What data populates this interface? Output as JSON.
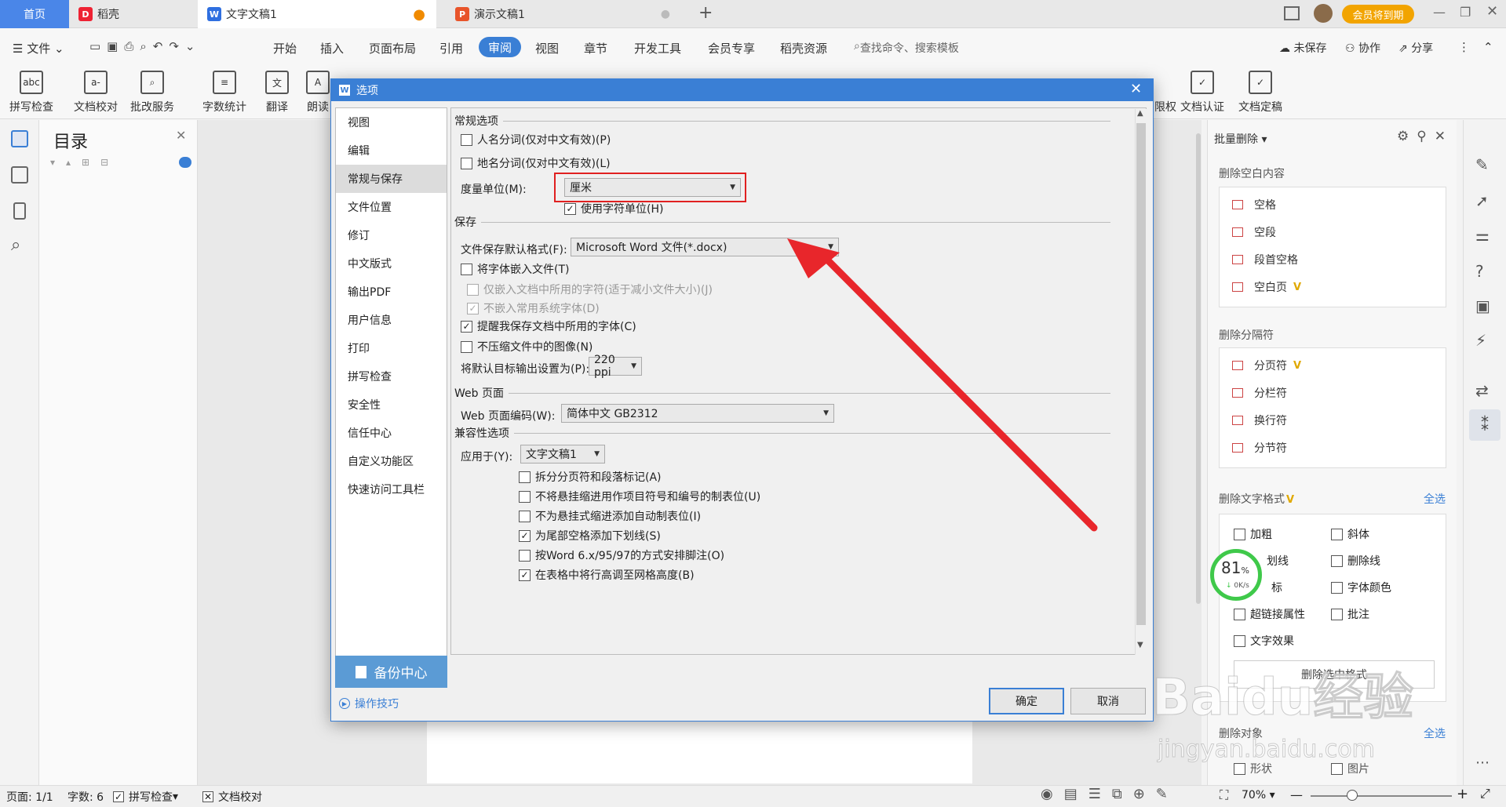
{
  "tabs": {
    "home": "首页",
    "daoke": "稻壳",
    "doc": "文字文稿1",
    "ppt": "演示文稿1",
    "vip_badge": "会员将到期"
  },
  "menu": {
    "file": "文件",
    "items": [
      "开始",
      "插入",
      "页面布局",
      "引用",
      "审阅",
      "视图",
      "章节",
      "开发工具",
      "会员专享",
      "稻壳资源"
    ],
    "active": "审阅",
    "search_placeholder": "查找命令、搜索模板",
    "unsaved": "未保存",
    "collab": "协作",
    "share": "分享"
  },
  "ribbon": {
    "left": [
      {
        "label": "拼写检查",
        "icon": "abc"
      },
      {
        "label": "文档校对",
        "icon": "a-"
      },
      {
        "label": "批改服务",
        "icon": "lens"
      },
      {
        "label": "字数统计",
        "icon": "lines"
      },
      {
        "label": "翻译",
        "icon": "translate"
      },
      {
        "label": "朗读",
        "icon": "A"
      }
    ],
    "right": [
      {
        "label": "限权",
        "icon": "lock"
      },
      {
        "label": "文档认证",
        "icon": "doc-check"
      },
      {
        "label": "文档定稿",
        "icon": "doc-final"
      }
    ]
  },
  "toc": {
    "title": "目录"
  },
  "dialog": {
    "title": "选项",
    "nav": [
      "视图",
      "编辑",
      "常规与保存",
      "文件位置",
      "修订",
      "中文版式",
      "输出PDF",
      "用户信息",
      "打印",
      "拼写检查",
      "安全性",
      "信任中心",
      "自定义功能区",
      "快速访问工具栏"
    ],
    "nav_selected": "常规与保存",
    "backup": "备份中心",
    "tips": "操作技巧",
    "sections": {
      "general": "常规选项",
      "save": "保存",
      "web": "Web 页面",
      "compat": "兼容性选项"
    },
    "general": {
      "name_seg": "人名分词(仅对中文有效)(P)",
      "place_seg": "地名分词(仅对中文有效)(L)",
      "unit_label": "度量单位(M):",
      "unit_value": "厘米",
      "use_char_unit": "使用字符单位(H)"
    },
    "save": {
      "format_label": "文件保存默认格式(F):",
      "format_value": "Microsoft Word 文件(*.docx)",
      "embed_font": "将字体嵌入文件(T)",
      "embed_used_only": "仅嵌入文档中所用的字符(适于减小文件大小)(J)",
      "no_embed_system": "不嵌入常用系统字体(D)",
      "remind_font": "提醒我保存文档中所用的字体(C)",
      "no_compress": "不压缩文件中的图像(N)",
      "ppi_label": "将默认目标输出设置为(P):",
      "ppi_value": "220 ppi"
    },
    "web": {
      "encoding_label": "Web 页面编码(W):",
      "encoding_value": "简体中文 GB2312"
    },
    "compat": {
      "apply_label": "应用于(Y):",
      "apply_value": "文字文稿1",
      "opt1": "拆分分页符和段落标记(A)",
      "opt2": "不将悬挂缩进用作项目符号和编号的制表位(U)",
      "opt3": "不为悬挂式缩进添加自动制表位(I)",
      "opt4": "为尾部空格添加下划线(S)",
      "opt5": "按Word 6.x/95/97的方式安排脚注(O)",
      "opt6": "在表格中将行高调至网格高度(B)"
    },
    "ok": "确定",
    "cancel": "取消"
  },
  "right_panel": {
    "header": "批量删除",
    "group1_title": "删除空白内容",
    "group1": [
      "空格",
      "空段",
      "段首空格",
      "空白页"
    ],
    "group2_title": "删除分隔符",
    "group2": [
      "分页符",
      "分栏符",
      "换行符",
      "分节符"
    ],
    "group3_title": "删除文字格式",
    "select_all": "全选",
    "group3": [
      "加粗",
      "斜体",
      "划线",
      "删除线",
      "标",
      "字体颜色",
      "超链接属性",
      "批注",
      "文字效果"
    ],
    "delete_selected": "删除选中格式",
    "group4_title": "删除对象",
    "group4": [
      "形状",
      "图片"
    ],
    "speed_percent": "81",
    "speed_unit": "%",
    "speed_rate": "0K/s"
  },
  "status": {
    "page": "页面: 1/1",
    "words": "字数: 6",
    "spell": "拼写检查",
    "proof": "文档校对",
    "zoom": "70%"
  },
  "watermark": {
    "main": "Baidu经验",
    "sub": "jingyan.baidu.com"
  },
  "colors": {
    "accent": "#3a7fd5",
    "highlight_box": "#e02020",
    "arrow": "#e8262b",
    "vip": "#e0a800"
  }
}
